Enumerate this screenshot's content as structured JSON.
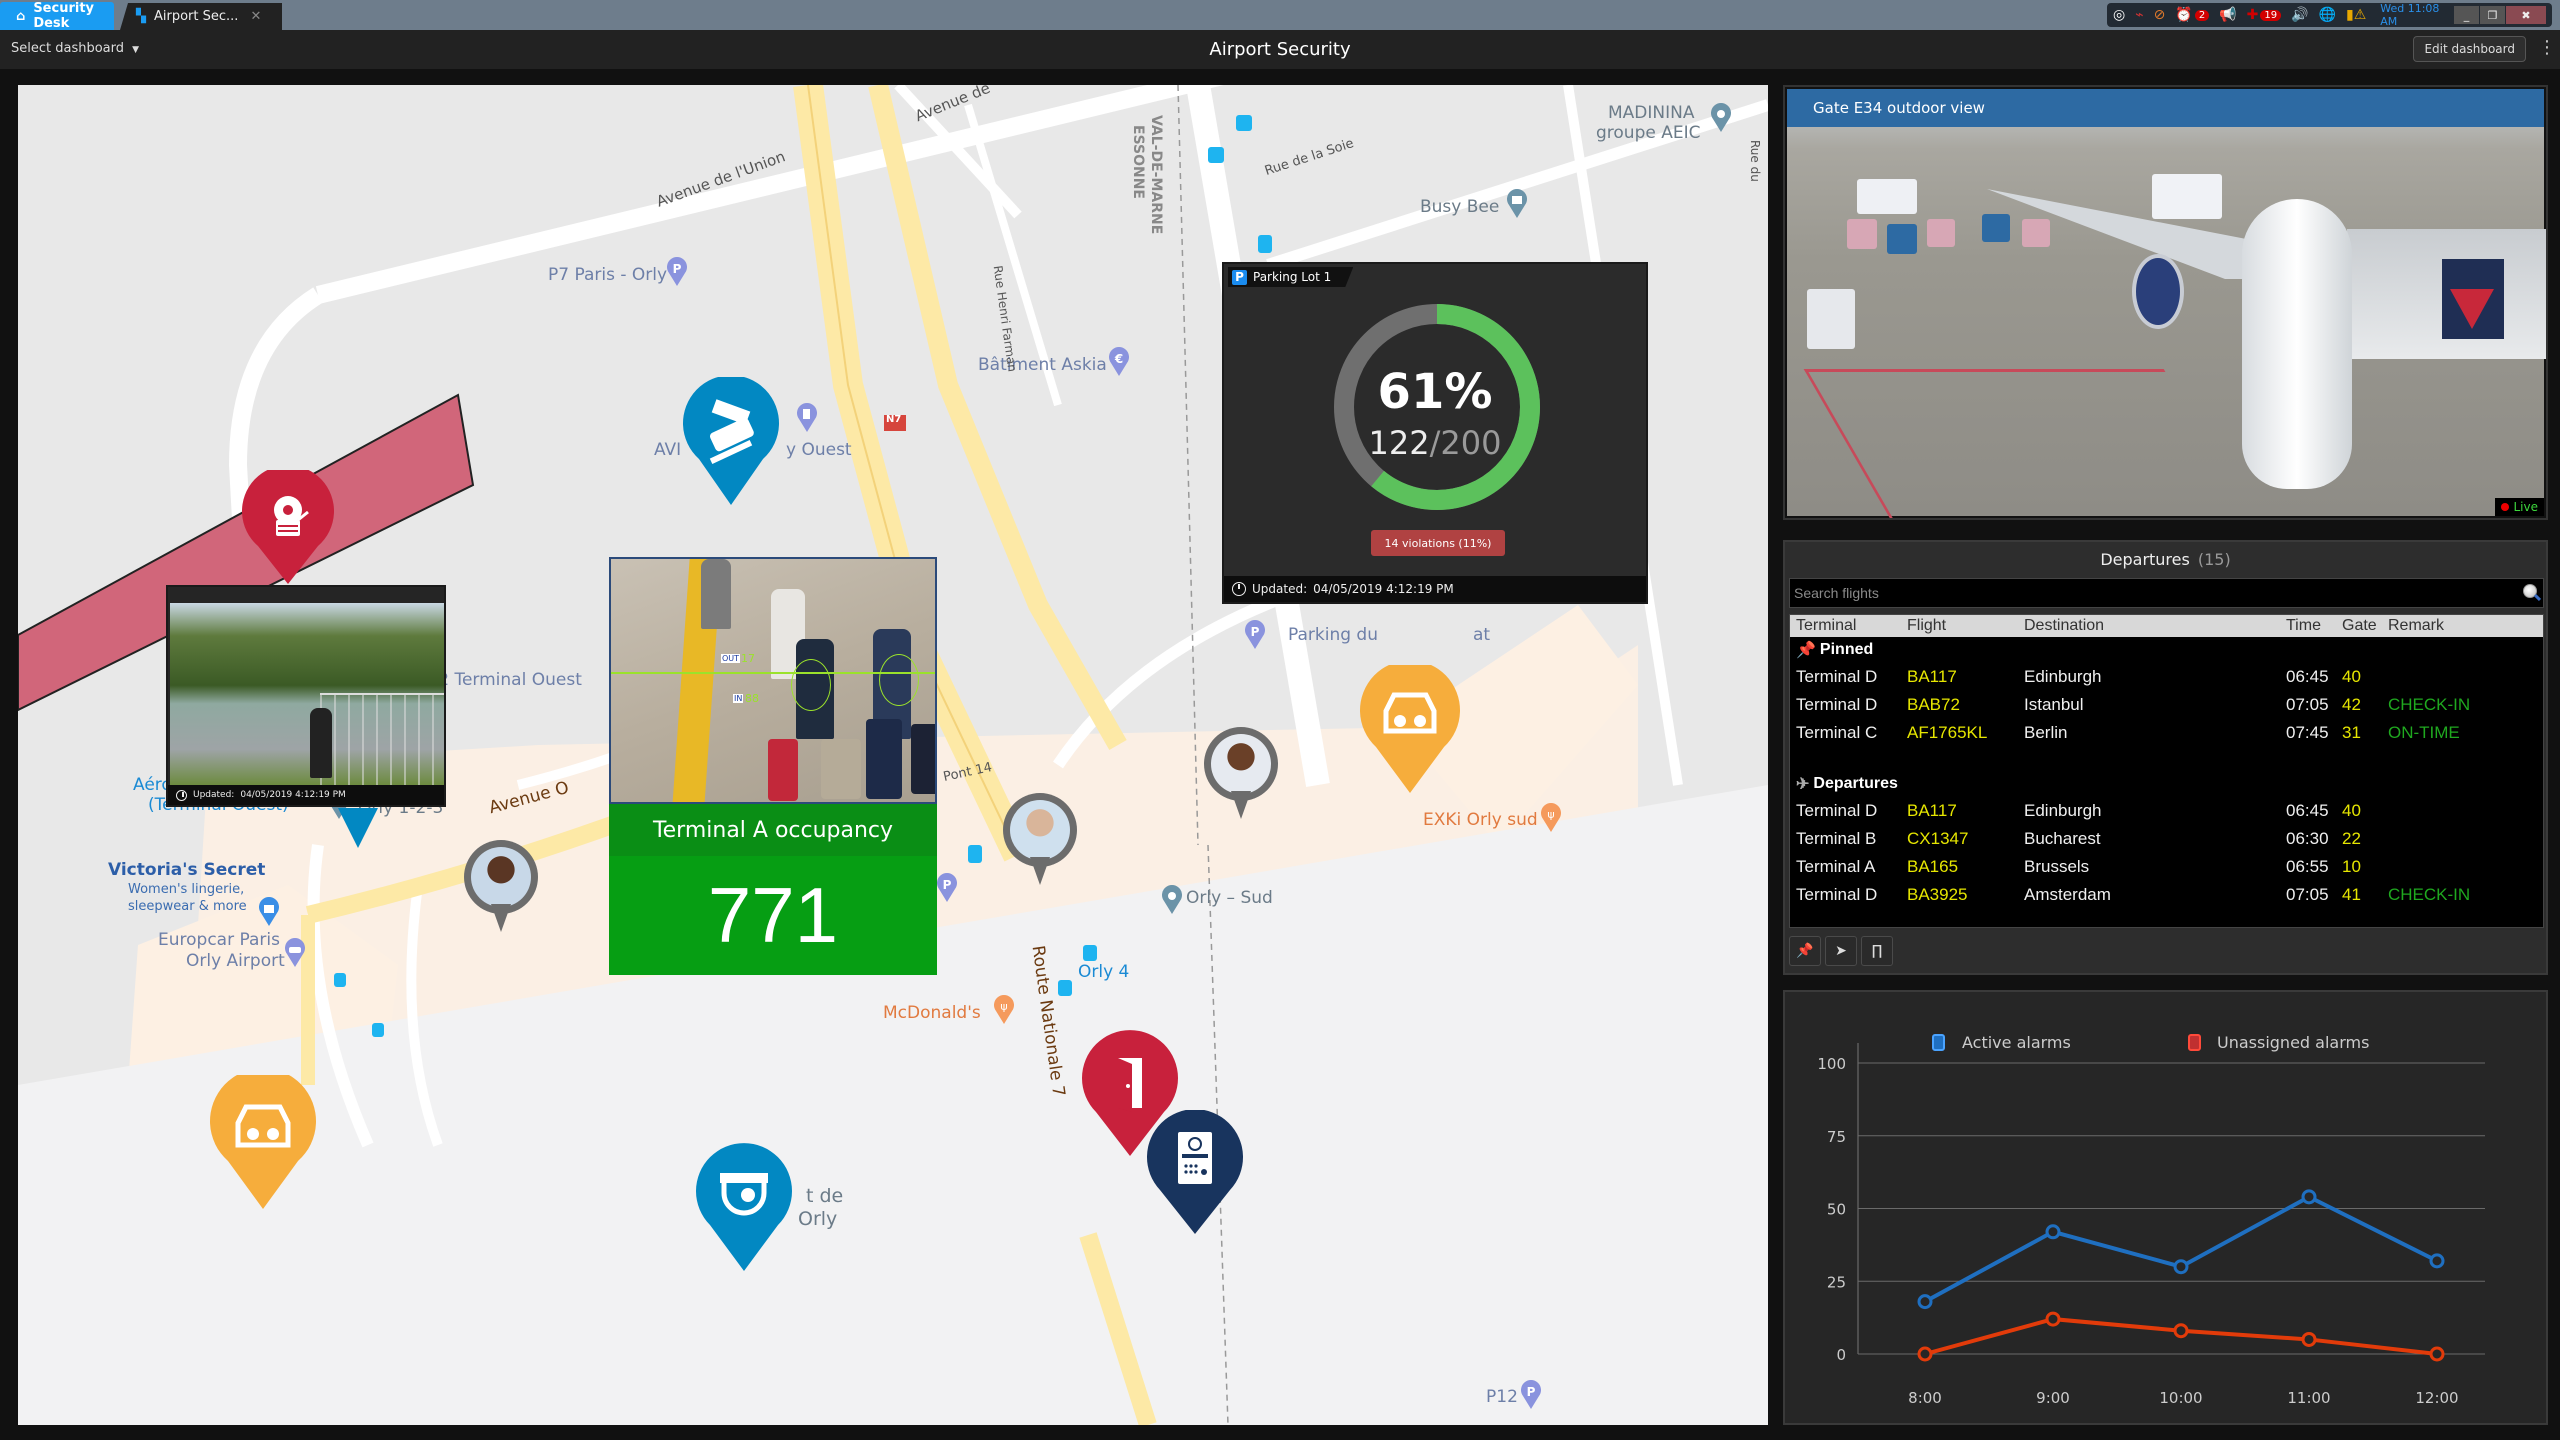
{
  "titlebar": {
    "home_tab": "Security Desk",
    "active_tab": "Airport Sec...",
    "tray": {
      "alarm_badge": "2",
      "health_badge": "19",
      "clock": "Wed 11:08 AM"
    }
  },
  "toolbar": {
    "select_dashboard": "Select dashboard",
    "title": "Airport Security",
    "edit_dashboard": "Edit dashboard"
  },
  "map": {
    "labels": {
      "avenue_union": "Avenue de l'Union",
      "avenue_de": "Avenue de",
      "p7": "P7 Paris - Orly",
      "batiment": "Bâtiment Askia",
      "val_de_marne_1": "VAL-DE-MARNE",
      "val_de_marne_2": "ESSONNE",
      "rue_henri": "Rue Henri Farman",
      "rue_soie": "Rue de la Soie",
      "busy_bee": "Busy Bee",
      "madinina_1": "MADININA",
      "madinina_2": "groupe AEIC",
      "rue_du": "Rue du",
      "n7": "N7",
      "avi_ouest_a": "AVI",
      "avi_ouest_b": "y Ouest",
      "p2": "P2 Terminal Ouest",
      "aeroport_1": "Aéroport Orly 1-2-3",
      "aeroport_2": "(Terminal Ouest)",
      "orly123": "Orly 1-2-3",
      "avenue_o": "Avenue O",
      "victoria_1": "Victoria's Secret",
      "victoria_2": "Women's lingerie,",
      "victoria_3": "sleepwear & more",
      "europcar_1": "Europcar Paris",
      "europcar_2": "Orly Airport",
      "pont14": "Pont 14",
      "orly_sud": "Orly – Sud",
      "orly4": "Orly 4",
      "mcdonalds": "McDonald's",
      "route_nat": "Route Nationale 7",
      "parking_du": "Parking du",
      "parking_at": "at",
      "exki": "EXKi Orly sud",
      "aeroport_de_1": "t de",
      "aeroport_de_2": "Orly",
      "p12": "P12"
    },
    "parking_widget": {
      "title": "Parking Lot 1",
      "percent_label": "61%",
      "occupied": "122",
      "capacity": "/200",
      "occupancy_fraction": 0.61,
      "violations": "14 violations (11%)",
      "updated_label": "Updated:",
      "updated_value": "04/05/2019 4:12:19 PM"
    },
    "fence_camera": {
      "updated_label": "Updated:",
      "updated_value": "04/05/2019 4:12:19 PM"
    },
    "occupancy_widget": {
      "out_label": "OUT",
      "out_count": "17",
      "in_label": "IN",
      "in_count": "88",
      "title": "Terminal A occupancy",
      "value": "771"
    }
  },
  "camera": {
    "title": "Gate E34 outdoor view",
    "live": "Live"
  },
  "departures": {
    "title": "Departures",
    "count": "(15)",
    "search_placeholder": "Search flights",
    "columns": [
      "Terminal",
      "Flight",
      "Destination",
      "Time",
      "Gate",
      "Remark"
    ],
    "pinned_label": "Pinned",
    "pinned": [
      {
        "terminal": "Terminal D",
        "flight": "BA117",
        "destination": "Edinburgh",
        "time": "06:45",
        "gate": "40",
        "remark": ""
      },
      {
        "terminal": "Terminal D",
        "flight": "BAB72",
        "destination": "Istanbul",
        "time": "07:05",
        "gate": "42",
        "remark": "CHECK-IN"
      },
      {
        "terminal": "Terminal C",
        "flight": "AF1765KL",
        "destination": "Berlin",
        "time": "07:45",
        "gate": "31",
        "remark": "ON-TIME"
      }
    ],
    "departures_label": "Departures",
    "rows": [
      {
        "terminal": "Terminal D",
        "flight": "BA117",
        "destination": "Edinburgh",
        "time": "06:45",
        "gate": "40",
        "remark": ""
      },
      {
        "terminal": "Terminal B",
        "flight": "CX1347",
        "destination": "Bucharest",
        "time": "06:30",
        "gate": "22",
        "remark": ""
      },
      {
        "terminal": "Terminal A",
        "flight": "BA165",
        "destination": "Brussels",
        "time": "06:55",
        "gate": "10",
        "remark": ""
      },
      {
        "terminal": "Terminal D",
        "flight": "BA3925",
        "destination": "Amsterdam",
        "time": "07:05",
        "gate": "41",
        "remark": "CHECK-IN"
      }
    ]
  },
  "colors": {
    "accent_blue": "#1a9cf2",
    "occupancy_green": "#069e13",
    "donut_green": "#5cc15c",
    "violation_red": "#b04242",
    "flight_yellow": "#e6e600",
    "remark_green": "#1fa81f",
    "series_active": "#1f6fc0",
    "series_unassigned": "#e23b0a"
  },
  "chart_data": {
    "type": "line",
    "title": "",
    "xlabel": "",
    "ylabel": "",
    "categories": [
      "8:00",
      "9:00",
      "10:00",
      "11:00",
      "12:00"
    ],
    "series": [
      {
        "name": "Active alarms",
        "values": [
          18,
          42,
          30,
          54,
          32
        ]
      },
      {
        "name": "Unassigned alarms",
        "values": [
          0,
          12,
          8,
          5,
          0
        ]
      }
    ],
    "yticks": [
      0,
      25,
      50,
      75,
      100
    ],
    "ylim": [
      0,
      100
    ],
    "grid": true,
    "legend": "top-center"
  }
}
